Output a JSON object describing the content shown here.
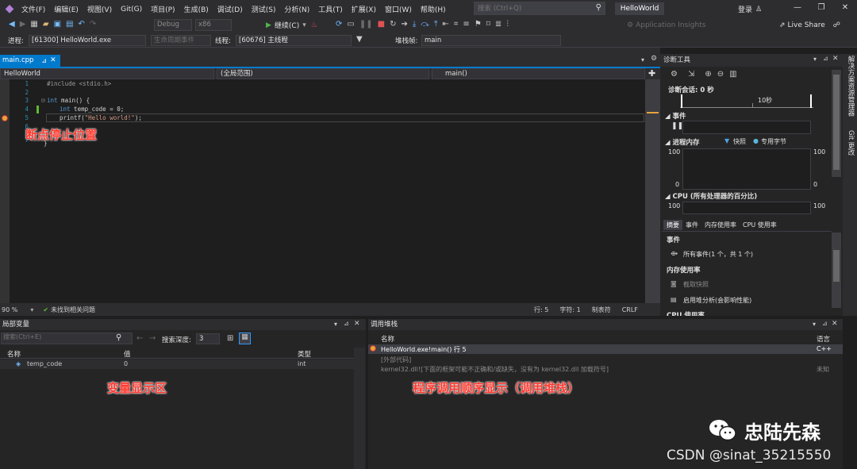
{
  "menubar": {
    "items": [
      "文件(F)",
      "编辑(E)",
      "视图(V)",
      "Git(G)",
      "项目(P)",
      "生成(B)",
      "调试(D)",
      "测试(S)",
      "分析(N)",
      "工具(T)",
      "扩展(X)",
      "窗口(W)",
      "帮助(H)"
    ],
    "search_placeholder": "搜索 (Ctrl+Q)",
    "app_title": "HelloWorld",
    "login": "登录"
  },
  "toolbar": {
    "config": "Debug",
    "platform": "x86",
    "continue": "继续(C)",
    "insights": "Application Insights",
    "live_share": "Live Share"
  },
  "debugbar": {
    "process_label": "进程:",
    "process": "[61300] HelloWorld.exe",
    "lifecycle": "生命周期事件",
    "thread_label": "线程:",
    "thread": "[60676] 主线程",
    "stack_label": "堆栈帧:",
    "stack": "main"
  },
  "editor": {
    "tab": "main.cpp",
    "nav_project": "HelloWorld",
    "nav_scope": "(全局范围)",
    "nav_func": "main()",
    "lines": [
      "1",
      "2",
      "3",
      "4",
      "5",
      "6",
      "7"
    ],
    "code": {
      "l1": "#include <stdio.h>",
      "l3_kw": "int",
      "l3_rest": " main() {",
      "l4_kw": "int",
      "l4_rest": " temp_code = 0;",
      "l5_fn": "printf(",
      "l5_str": "\"Hello world!\"",
      "l5_end": ");",
      "l7": "}"
    },
    "annotation": "断点停止位置",
    "status": {
      "zoom": "90 %",
      "issues": "未找到相关问题",
      "line": "行: 5",
      "col": "字符: 1",
      "tabs": "制表符",
      "eol": "CRLF"
    }
  },
  "diagnostics": {
    "title": "诊断工具",
    "session": "诊断会话: 0 秒",
    "time_mark": "10秒",
    "events": "事件",
    "memory": "进程内存",
    "snapshot": "快照",
    "private_bytes": "专用字节",
    "mem_max_left": "100",
    "mem_max_right": "100",
    "mem_min_left": "0",
    "mem_min_right": "0",
    "cpu": "CPU (所有处理器的百分比)",
    "cpu_max_left": "100",
    "cpu_max_right": "100",
    "tabs": [
      "摘要",
      "事件",
      "内存使用率",
      "CPU 使用率"
    ],
    "events_section": "事件",
    "all_events": "所有事件(1 个，共 1 个)",
    "mem_section": "内存使用率",
    "take_snapshot": "截取快照",
    "heap_analysis": "启用堆分析(会影响性能)",
    "cpu_section": "CPU 使用率",
    "side_tabs": [
      "解决方案资源管理器",
      "Git 更改"
    ]
  },
  "locals": {
    "title": "局部变量",
    "search_placeholder": "搜索(Ctrl+E)",
    "depth_label": "搜索深度:",
    "depth": "3",
    "columns": [
      "名称",
      "值",
      "类型"
    ],
    "rows": [
      {
        "name": "temp_code",
        "value": "0",
        "type": "int"
      }
    ],
    "annotation": "变量显示区"
  },
  "callstack": {
    "title": "调用堆栈",
    "columns": [
      "名称",
      "语言"
    ],
    "rows": [
      {
        "name": "HelloWorld.exe!main() 行 5",
        "lang": "C++"
      },
      {
        "name": "[外部代码]",
        "lang": ""
      },
      {
        "name": "kernel32.dll![下面的框架可能不正确和/或缺失，没有为 kernel32.dll 加载符号]",
        "lang": "未知"
      }
    ],
    "annotation": "程序调用顺序显示（调用堆栈）"
  },
  "watermark": {
    "brand": "忠陆先森",
    "csdn": "CSDN @sinat_35215550"
  }
}
